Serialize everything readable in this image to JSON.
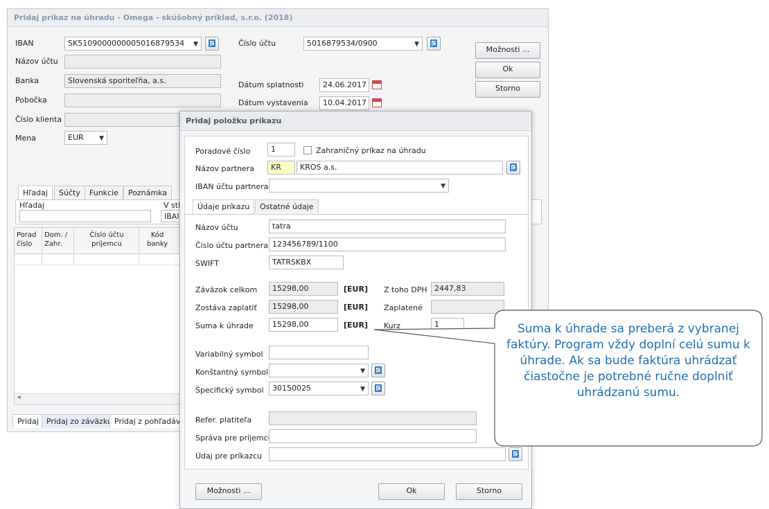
{
  "main_window": {
    "title": "Pridaj príkaz na úhradu - Omega - skúšobný príklad, s.r.o. (2018)",
    "iban_label": "IBAN",
    "iban_value": "SK5109000000005016879534",
    "nazov_uctu_label": "Názov účtu",
    "banka_label": "Banka",
    "banka_value": "Slovenská sporiteľňa, a.s.",
    "pobocka_label": "Pobočka",
    "cislo_klienta_label": "Číslo klienta",
    "mena_label": "Mena",
    "mena_value": "EUR",
    "cislo_uctu_label": "Číslo účtu",
    "cislo_uctu_value": "5016879534/0900",
    "datum_splatnosti_label": "Dátum splatnosti",
    "datum_splatnosti_value": "24.06.2017",
    "datum_vystavenia_label": "Dátum vystavenia",
    "datum_vystavenia_value": "10.04.2017",
    "moznosti_button": "Možnosti ...",
    "ok_button": "Ok",
    "storno_button": "Storno",
    "tabs": [
      "Hľadaj",
      "Súčty",
      "Funkcie",
      "Poznámka"
    ],
    "search_label": "Hľadaj",
    "v_stl_label": "V stĺ",
    "v_stl_value": "IBAI",
    "grid_headers": [
      {
        "l1": "Porad",
        "l2": "číslo"
      },
      {
        "l1": "Dom. /",
        "l2": "Zahr."
      },
      {
        "l1": "Číslo účtu",
        "l2": "príjemcu"
      },
      {
        "l1": "Kód",
        "l2": "banky"
      }
    ],
    "bottom_tabs": [
      "Pridaj",
      "Pridaj zo záväzku",
      "Pridaj z pohľadávk"
    ]
  },
  "dialog": {
    "title": "Pridaj položku príkazu",
    "poradove_cislo_label": "Poradové číslo",
    "poradove_cislo_value": "1",
    "zahranicny_label": "Zahraničný príkaz na úhradu",
    "nazov_partnera_label": "Názov partnera",
    "partner_code": "KR",
    "partner_name": "KROS a.s.",
    "iban_partnera_label": "IBAN účtu partnera",
    "tabs": [
      "Údaje príkazu",
      "Ostatné údaje"
    ],
    "nazov_uctu_label": "Názov účtu",
    "nazov_uctu_value": "tatra",
    "cislo_uctu_partnera_label": "Číslo účtu partnera",
    "cislo_uctu_partnera_value": "123456789/1100",
    "swift_label": "SWIFT",
    "swift_value": "TATRSKBX",
    "zavazok_celkom_label": "Záväzok celkom",
    "zavazok_celkom_value": "15298,00",
    "zostava_zaplatit_label": "Zostáva zaplatiť",
    "zostava_zaplatit_value": "15298,00",
    "suma_k_uhrade_label": "Suma k úhrade",
    "suma_k_uhrade_value": "15298,00",
    "currency": "[EUR]",
    "z_toho_dph_label": "Z toho DPH",
    "z_toho_dph_value": "2447,83",
    "zaplatene_label": "Zaplatené",
    "kurz_label": "Kurz",
    "kurz_value": "1",
    "variabilny_label": "Variabilný symbol",
    "konstantny_label": "Konštantný symbol",
    "specificky_label": "Špecifický symbol",
    "specificky_value": "30150025",
    "refer_label": "Refer. platiteľa",
    "sprava_label": "Správa pre príjemcu",
    "udaj_label": "Údaj pre príkazcu",
    "moznosti_button": "Možnosti ...",
    "ok_button": "Ok",
    "storno_button": "Storno"
  },
  "callout": {
    "text": "Suma k úhrade sa preberá z vybranej faktúry. Program vždy doplní celú sumu k úhrade. Ak sa bude faktúra uhrádzať čiastočne je potrebné ručne doplniť uhrádzanú sumu."
  },
  "colors": {
    "title_text": "#8a9ab2",
    "dialog_title_bg": "#e9ebef",
    "callout_text": "#1f6fb5"
  }
}
